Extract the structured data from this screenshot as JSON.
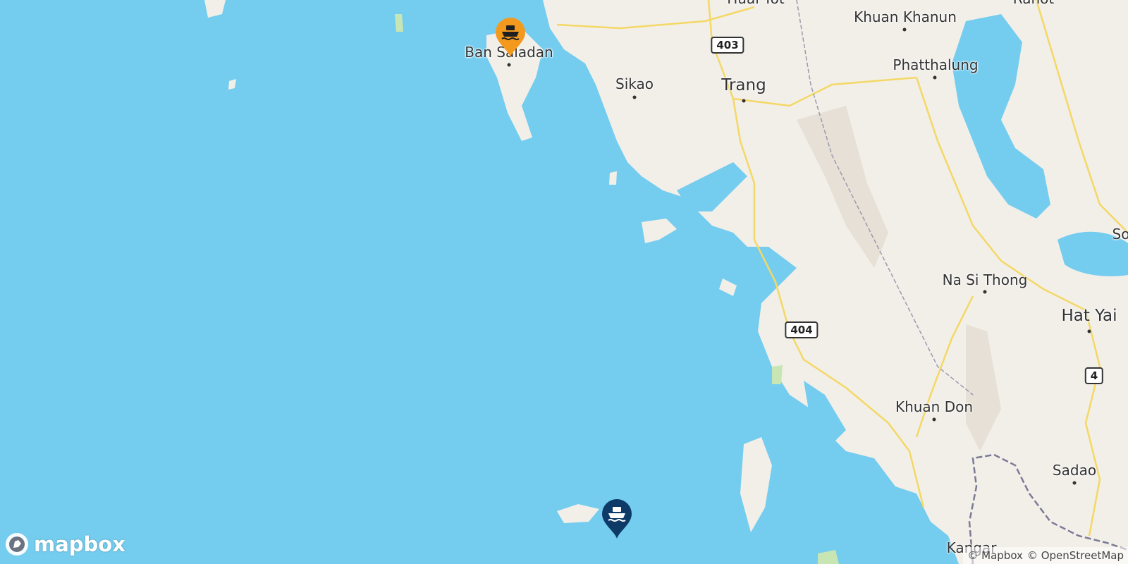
{
  "map": {
    "colors": {
      "water": "#74cdef",
      "land": "#f2efe9",
      "road": "#f4d865",
      "border": "#8a8aa0"
    },
    "places": {
      "ban_saladan": "Ban Saladan",
      "huai_yot": "Huai Yot",
      "khuan_khanun": "Khuan Khanun",
      "ranot": "Ranot",
      "phatthalung": "Phatthalung",
      "sikao": "Sikao",
      "trang": "Trang",
      "songkhla": "So",
      "na_si_thong": "Na Si Thong",
      "hat_yai": "Hat Yai",
      "khuan_don": "Khuan Don",
      "sadao": "Sadao",
      "kangar": "Kangar"
    },
    "roads": {
      "r403": "403",
      "r404": "404",
      "r4": "4"
    },
    "markers": {
      "origin": {
        "icon": "ferry-icon",
        "color": "#f39a1e"
      },
      "destination": {
        "icon": "ferry-icon",
        "color": "#0d3a66"
      }
    }
  },
  "branding": {
    "logo_text": "mapbox",
    "attribution": [
      "© Mapbox",
      "© OpenStreetMap"
    ]
  }
}
